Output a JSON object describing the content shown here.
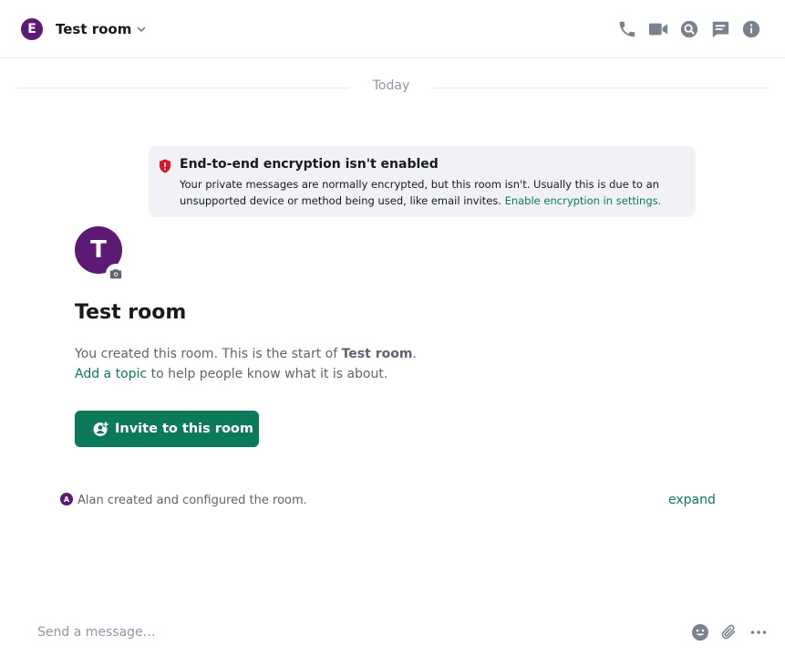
{
  "colors": {
    "accent": "#0a7a5b",
    "avatar": "#5c1a74",
    "icon": "#7a828e",
    "critical": "#d51928"
  },
  "header": {
    "avatar_letter": "E",
    "room_name": "Test room",
    "icons": [
      "voice-call-icon",
      "video-call-icon",
      "search-icon",
      "threads-icon",
      "info-icon",
      "chevron-down-icon"
    ]
  },
  "timeline": {
    "date_separator": "Today"
  },
  "encryption_notice": {
    "title": "End-to-end encryption isn't enabled",
    "description": "Your private messages are normally encrypted, but this room isn't. Usually this is due to an unsupported device or method being used, like email invites.",
    "link": "Enable encryption in settings."
  },
  "room_intro": {
    "avatar_letter": "T",
    "title": "Test room",
    "created_prefix": "You created this room. This is the start of",
    "room_name_bold": "Test room",
    "period": ".",
    "add_topic": "Add a topic",
    "topic_suffix": "to help people know what it is about.",
    "invite_button": "Invite to this room"
  },
  "summary": {
    "avatar_letter": "A",
    "text": "Alan created and configured the room.",
    "expand": "expand"
  },
  "composer": {
    "placeholder": "Send a message…",
    "icons": [
      "emoji-icon",
      "attachment-icon",
      "more-options-icon"
    ]
  }
}
